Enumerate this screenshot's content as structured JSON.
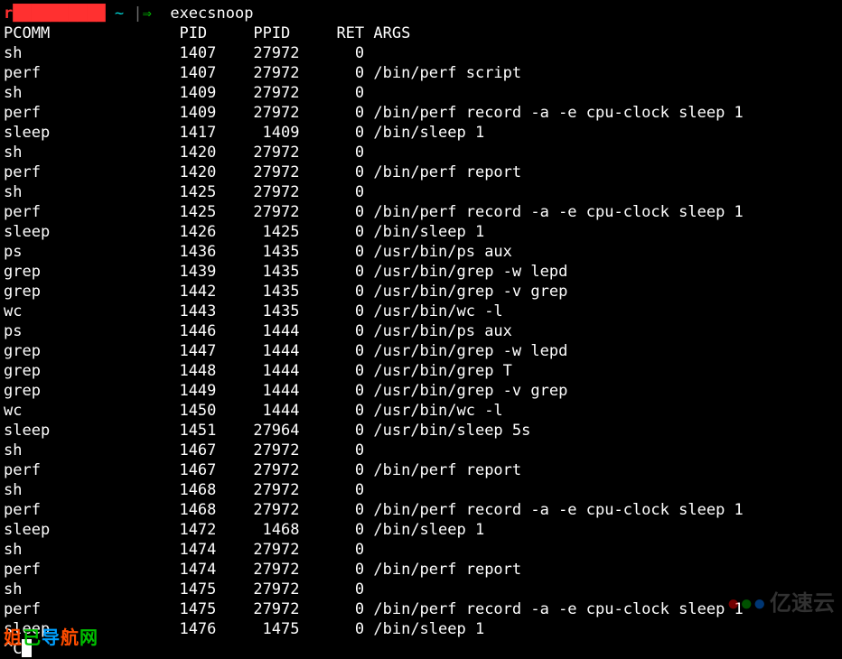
{
  "prompt": {
    "user": "r██████████",
    "sep_tilde": "~",
    "sep_pipe": "|",
    "sep_arrow": "⇒",
    "command": "execsnoop"
  },
  "header": {
    "pcomm": "PCOMM",
    "pid": "PID",
    "ppid": "PPID",
    "ret": "RET",
    "args": "ARGS"
  },
  "rows": [
    {
      "pcomm": "sh",
      "pid": "1407",
      "ppid": "27972",
      "ret": "0",
      "args": ""
    },
    {
      "pcomm": "perf",
      "pid": "1407",
      "ppid": "27972",
      "ret": "0",
      "args": "/bin/perf script"
    },
    {
      "pcomm": "sh",
      "pid": "1409",
      "ppid": "27972",
      "ret": "0",
      "args": ""
    },
    {
      "pcomm": "perf",
      "pid": "1409",
      "ppid": "27972",
      "ret": "0",
      "args": "/bin/perf record -a -e cpu-clock sleep 1"
    },
    {
      "pcomm": "sleep",
      "pid": "1417",
      "ppid": "1409",
      "ret": "0",
      "args": "/bin/sleep 1"
    },
    {
      "pcomm": "sh",
      "pid": "1420",
      "ppid": "27972",
      "ret": "0",
      "args": ""
    },
    {
      "pcomm": "perf",
      "pid": "1420",
      "ppid": "27972",
      "ret": "0",
      "args": "/bin/perf report"
    },
    {
      "pcomm": "sh",
      "pid": "1425",
      "ppid": "27972",
      "ret": "0",
      "args": ""
    },
    {
      "pcomm": "perf",
      "pid": "1425",
      "ppid": "27972",
      "ret": "0",
      "args": "/bin/perf record -a -e cpu-clock sleep 1"
    },
    {
      "pcomm": "sleep",
      "pid": "1426",
      "ppid": "1425",
      "ret": "0",
      "args": "/bin/sleep 1"
    },
    {
      "pcomm": "ps",
      "pid": "1436",
      "ppid": "1435",
      "ret": "0",
      "args": "/usr/bin/ps aux"
    },
    {
      "pcomm": "grep",
      "pid": "1439",
      "ppid": "1435",
      "ret": "0",
      "args": "/usr/bin/grep -w lepd"
    },
    {
      "pcomm": "grep",
      "pid": "1442",
      "ppid": "1435",
      "ret": "0",
      "args": "/usr/bin/grep -v grep"
    },
    {
      "pcomm": "wc",
      "pid": "1443",
      "ppid": "1435",
      "ret": "0",
      "args": "/usr/bin/wc -l"
    },
    {
      "pcomm": "ps",
      "pid": "1446",
      "ppid": "1444",
      "ret": "0",
      "args": "/usr/bin/ps aux"
    },
    {
      "pcomm": "grep",
      "pid": "1447",
      "ppid": "1444",
      "ret": "0",
      "args": "/usr/bin/grep -w lepd"
    },
    {
      "pcomm": "grep",
      "pid": "1448",
      "ppid": "1444",
      "ret": "0",
      "args": "/usr/bin/grep T"
    },
    {
      "pcomm": "grep",
      "pid": "1449",
      "ppid": "1444",
      "ret": "0",
      "args": "/usr/bin/grep -v grep"
    },
    {
      "pcomm": "wc",
      "pid": "1450",
      "ppid": "1444",
      "ret": "0",
      "args": "/usr/bin/wc -l"
    },
    {
      "pcomm": "sleep",
      "pid": "1451",
      "ppid": "27964",
      "ret": "0",
      "args": "/usr/bin/sleep 5s"
    },
    {
      "pcomm": "sh",
      "pid": "1467",
      "ppid": "27972",
      "ret": "0",
      "args": ""
    },
    {
      "pcomm": "perf",
      "pid": "1467",
      "ppid": "27972",
      "ret": "0",
      "args": "/bin/perf report"
    },
    {
      "pcomm": "sh",
      "pid": "1468",
      "ppid": "27972",
      "ret": "0",
      "args": ""
    },
    {
      "pcomm": "perf",
      "pid": "1468",
      "ppid": "27972",
      "ret": "0",
      "args": "/bin/perf record -a -e cpu-clock sleep 1"
    },
    {
      "pcomm": "sleep",
      "pid": "1472",
      "ppid": "1468",
      "ret": "0",
      "args": "/bin/sleep 1"
    },
    {
      "pcomm": "sh",
      "pid": "1474",
      "ppid": "27972",
      "ret": "0",
      "args": ""
    },
    {
      "pcomm": "perf",
      "pid": "1474",
      "ppid": "27972",
      "ret": "0",
      "args": "/bin/perf report"
    },
    {
      "pcomm": "sh",
      "pid": "1475",
      "ppid": "27972",
      "ret": "0",
      "args": ""
    },
    {
      "pcomm": "perf",
      "pid": "1475",
      "ppid": "27972",
      "ret": "0",
      "args": "/bin/perf record -a -e cpu-clock sleep 1"
    },
    {
      "pcomm": "sleep",
      "pid": "1476",
      "ppid": "1475",
      "ret": "0",
      "args": "/bin/sleep 1"
    }
  ],
  "interrupt": "^C",
  "watermarks": {
    "yyy": "亿速云",
    "dhw": "姐已导航网"
  }
}
